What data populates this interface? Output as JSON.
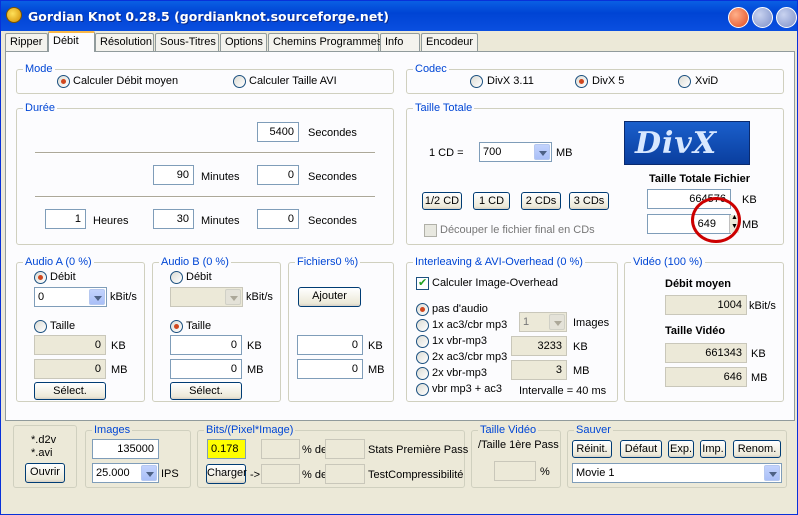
{
  "window": {
    "title": "Gordian Knot 0.28.5 (gordianknot.sourceforge.net)"
  },
  "tabs": [
    "Ripper",
    "Débit",
    "Résolution",
    "Sous-Titres",
    "Options",
    "Chemins Programmes",
    "Info",
    "Encodeur"
  ],
  "mode": {
    "legend": "Mode",
    "opt1": "Calculer Débit moyen",
    "opt2": "Calculer Taille AVI"
  },
  "codec": {
    "legend": "Codec",
    "opt1": "DivX 3.11",
    "opt2": "DivX 5",
    "opt3": "XviD"
  },
  "duree": {
    "legend": "Durée",
    "seconds_total": "5400",
    "seconds_label": "Secondes",
    "minutes": "90",
    "minutes_label": "Minutes",
    "seconds2": "0",
    "hours": "1",
    "hours_label": "Heures",
    "minutes2": "30",
    "seconds3": "0"
  },
  "taille": {
    "legend": "Taille Totale",
    "cd_label": "1 CD =",
    "cd_value": "700",
    "mb": "MB",
    "b_half": "1/2 CD",
    "b_1": "1 CD",
    "b_2": "2 CDs",
    "b_3": "3 CDs",
    "split": "Découper le fichier final en CDs",
    "file_title": "Taille Totale Fichier",
    "kb_value": "664576",
    "kb": "KB",
    "mb_value": "649",
    "logo": "DivX"
  },
  "audioA": {
    "legend": "Audio A (0 %)",
    "debit": "Débit",
    "rate": "0",
    "unit": "kBit/s",
    "taille": "Taille",
    "kb_value": "0",
    "mb_value": "0",
    "kb": "KB",
    "mb": "MB",
    "select": "Sélect."
  },
  "audioB": {
    "legend": "Audio B (0 %)",
    "debit": "Débit",
    "unit": "kBit/s",
    "taille": "Taille",
    "kb_value": "0",
    "mb_value": "0",
    "kb": "KB",
    "mb": "MB",
    "select": "Sélect."
  },
  "fichiers": {
    "legend": "Fichiers0 %)",
    "add": "Ajouter",
    "kb_value": "0",
    "mb_value": "0",
    "kb": "KB",
    "mb": "MB"
  },
  "interleave": {
    "legend": "Interleaving & AVI-Overhead (0 %)",
    "calc": "Calculer  Image-Overhead",
    "o1": "pas d'audio",
    "o2": "1x ac3/cbr mp3",
    "o3": "1x vbr-mp3",
    "o4": "2x ac3/cbr mp3",
    "o5": "2x vbr-mp3",
    "o6": "vbr mp3 + ac3",
    "images_sel": "1",
    "images_label": "Images",
    "kb_value": "3233",
    "kb": "KB",
    "mb_value": "3",
    "mb": "MB",
    "interval": "Intervalle = 40 ms"
  },
  "video": {
    "legend": "Vidéo (100 %)",
    "debit_title": "Débit moyen",
    "debit_value": "1004",
    "debit_unit": "kBit/s",
    "taille_title": "Taille Vidéo",
    "kb_value": "661343",
    "kb": "KB",
    "mb_value": "646",
    "mb": "MB"
  },
  "bottom": {
    "src_line1": "*.d2v",
    "src_line2": "*.avi",
    "open": "Ouvrir",
    "images_legend": "Images",
    "frames": "135000",
    "fps": "25.000",
    "fps_label": "IPS",
    "bpp_legend": "Bits/(Pixel*Image)",
    "bpp_value": "0.178",
    "charger": "Charger",
    "arrow": "->",
    "pct1": "% de",
    "pct2": "% de",
    "stats1": "Stats Première Pass",
    "stats2": "TestCompressibilité",
    "tv_legend": "Taille Vidéo",
    "tv_sub": "/Taille 1ère Pass",
    "tv_pct": "%",
    "save_legend": "Sauver",
    "reinit": "Réinit.",
    "defaut": "Défaut",
    "exp": "Exp.",
    "imp": "Imp.",
    "renom": "Renom.",
    "movie": "Movie 1"
  },
  "colors": {
    "accent_tab": "#f9b848",
    "legend_blue": "#0046d5",
    "highlight_yellow": "#ffff00",
    "annotation_red": "#cc0000"
  }
}
